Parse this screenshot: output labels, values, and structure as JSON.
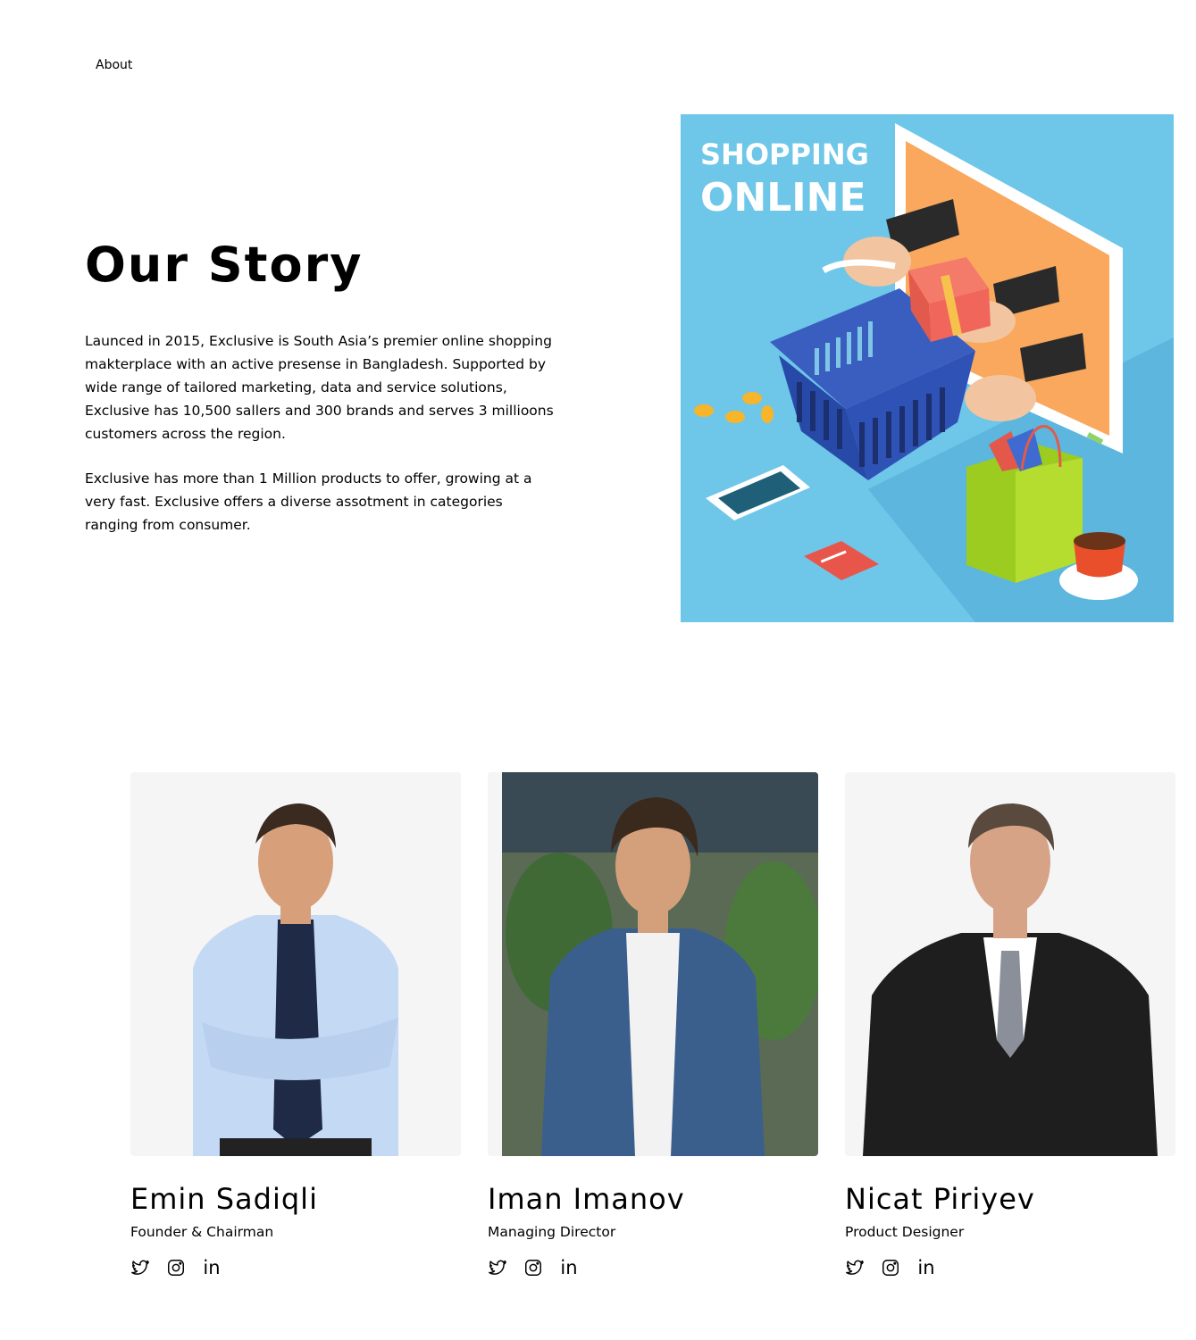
{
  "breadcrumb": {
    "current": "About"
  },
  "story": {
    "title": "Our Story",
    "paragraph1": "Launced in 2015, Exclusive is South Asia’s premier online shopping makterplace with an active presense in Bangladesh. Supported by wide range of tailored marketing, data and service solutions, Exclusive has 10,500 sallers and 300 brands and serves 3 millioons customers across the region.",
    "paragraph2": "Exclusive has more than 1 Million products to offer, growing at a very fast. Exclusive offers a diverse assotment in categories ranging  from consumer."
  },
  "hero": {
    "line1": "SHOPPING",
    "line2": "ONLINE",
    "bg_color": "#6ec6e8"
  },
  "team": [
    {
      "name": "Emin Sadiqli",
      "role": "Founder & Chairman",
      "socials": [
        "twitter-icon",
        "instagram-icon",
        "linkedin-icon"
      ]
    },
    {
      "name": "Iman Imanov",
      "role": "Managing Director",
      "socials": [
        "twitter-icon",
        "instagram-icon",
        "linkedin-icon"
      ]
    },
    {
      "name": "Nicat Piriyev",
      "role": "Product Designer",
      "socials": [
        "twitter-icon",
        "instagram-icon",
        "linkedin-icon"
      ]
    }
  ],
  "icons": {
    "linkedin_glyph": "in"
  }
}
